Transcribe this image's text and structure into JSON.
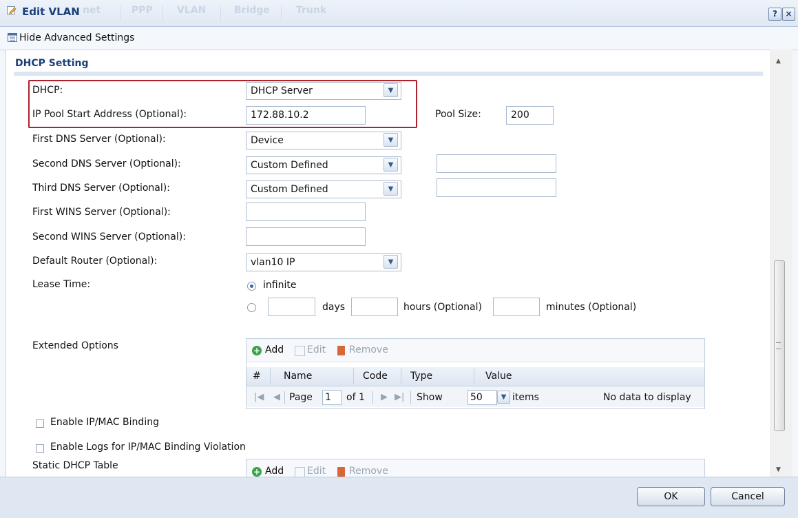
{
  "window": {
    "title": "Edit VLAN",
    "background_tabs": [
      "net",
      "PPP",
      "VLAN",
      "Bridge",
      "Trunk"
    ],
    "help_label": "?",
    "close_label": "×"
  },
  "toolbar": {
    "advanced_toggle": "Hide Advanced Settings"
  },
  "section": {
    "title": "DHCP Setting"
  },
  "form": {
    "dhcp": {
      "label": "DHCP:",
      "value": "DHCP Server"
    },
    "ip_pool_start": {
      "label": "IP Pool Start Address (Optional):",
      "value": "172.88.10.2"
    },
    "pool_size": {
      "label": "Pool Size:",
      "value": "200"
    },
    "first_dns": {
      "label": "First DNS Server (Optional):",
      "value": "Device"
    },
    "second_dns": {
      "label": "Second DNS Server (Optional):",
      "value": "Custom Defined",
      "custom_value": ""
    },
    "third_dns": {
      "label": "Third DNS Server (Optional):",
      "value": "Custom Defined",
      "custom_value": ""
    },
    "first_wins": {
      "label": "First WINS Server (Optional):",
      "value": ""
    },
    "second_wins": {
      "label": "Second WINS Server (Optional):",
      "value": ""
    },
    "default_router": {
      "label": "Default Router (Optional):",
      "value": "vlan10 IP"
    },
    "lease_time": {
      "label": "Lease Time:",
      "infinite_label": "infinite",
      "days_label": "days",
      "hours_label": "hours (Optional)",
      "minutes_label": "minutes (Optional)",
      "selected": "infinite"
    }
  },
  "extended_options": {
    "label": "Extended Options",
    "toolbar": {
      "add": "Add",
      "edit": "Edit",
      "remove": "Remove"
    },
    "columns": [
      "#",
      "Name",
      "Code",
      "Type",
      "Value"
    ],
    "pager": {
      "page_label": "Page",
      "page_value": "1",
      "of_label": "of 1",
      "show_label": "Show",
      "show_value": "50",
      "items_label": "items",
      "empty_text": "No data to display"
    }
  },
  "checkboxes": {
    "ip_mac_binding": {
      "label": "Enable IP/MAC Binding",
      "checked": false
    },
    "logs_binding_violation": {
      "label": "Enable Logs for IP/MAC Binding Violation",
      "checked": false
    }
  },
  "static_dhcp": {
    "label": "Static DHCP Table",
    "toolbar": {
      "add": "Add",
      "edit": "Edit",
      "remove": "Remove"
    }
  },
  "footer": {
    "ok": "OK",
    "cancel": "Cancel"
  },
  "colors": {
    "title": "#1a3f7a",
    "highlight_border": "#b0222a",
    "radio_selected": "#2e6bb8"
  }
}
